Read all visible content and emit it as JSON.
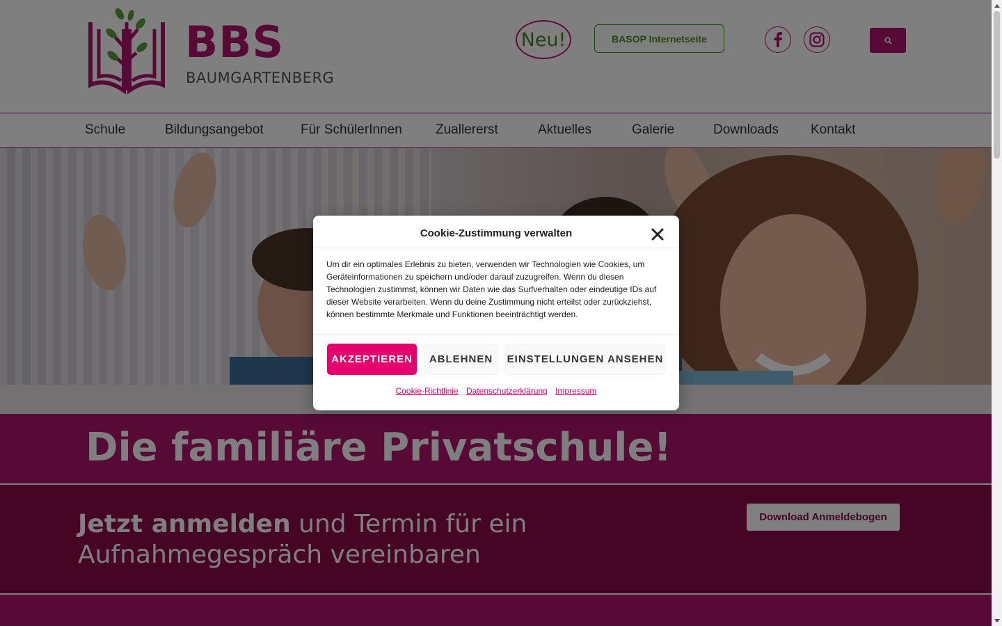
{
  "header": {
    "logo_title": "BBS",
    "logo_subtitle": "BAUMGARTENBERG",
    "neu_label": "Neu!",
    "basop_label": "BASOP Internetseite",
    "facebook_icon": "facebook-icon",
    "instagram_icon": "instagram-icon",
    "search_icon": "search-icon"
  },
  "nav": {
    "items": [
      {
        "label": "Schule"
      },
      {
        "label": "Bildungsangebot"
      },
      {
        "label": "Für SchülerInnen"
      },
      {
        "label": "Zuallererst"
      },
      {
        "label": "Aktuelles"
      },
      {
        "label": "Galerie"
      },
      {
        "label": "Downloads"
      },
      {
        "label": "Kontakt"
      }
    ]
  },
  "hero": {
    "tagline": "Die familiäre Privatschule!"
  },
  "cta": {
    "bold": "Jetzt anmelden",
    "rest": " und Termin für ein Auf­nahmegespräch vereinbaren",
    "button_label": "Download Anmeldebogen"
  },
  "cookie_modal": {
    "title": "Cookie-Zustimmung verwalten",
    "body": "Um dir ein optimales Erlebnis zu bieten, verwenden wir Technologien wie Cookies, um Geräteinformationen zu speichern und/oder darauf zuzugreifen. Wenn du diesen Technologien zustimmst, können wir Daten wie das Surfverhalten oder eindeutige IDs auf dieser Website verarbeiten. Wenn du deine Zustimmung nicht erteilst oder zurückziehst, können bestimmte Merkmale und Funktionen beeinträchtigt werden.",
    "accept_label": "AKZEPTIEREN",
    "deny_label": "ABLEHNEN",
    "settings_label": "EINSTELLUNGEN ANSEHEN",
    "links": [
      "Cookie-Richtlinie",
      "Datenschutzerklärung",
      "Impressum"
    ]
  },
  "colors": {
    "brand": "#b0156f",
    "brand_dark": "#8f0a4c",
    "accent_green": "#3d8b25",
    "cookie_accent": "#e5006e"
  }
}
